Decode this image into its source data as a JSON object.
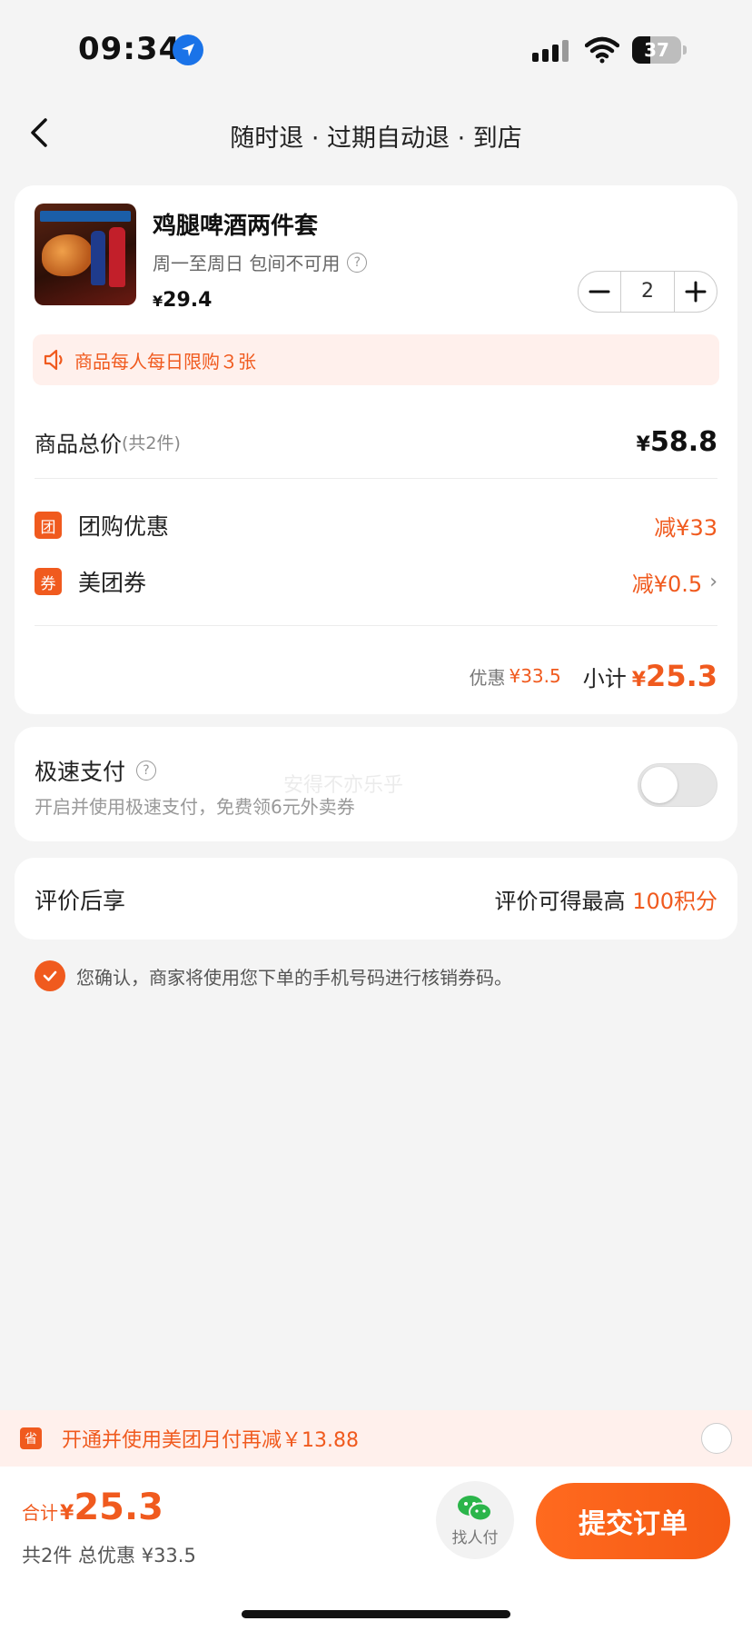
{
  "status_bar": {
    "time": "09:34",
    "battery": "37"
  },
  "nav": {
    "title": "随时退 · 过期自动退 · 到店"
  },
  "product": {
    "name": "鸡腿啤酒两件套",
    "availability": "周一至周日 包间不可用",
    "price_symbol": "¥",
    "price": "29.4",
    "quantity": "2",
    "limit_notice": "商品每人每日限购３张"
  },
  "summary": {
    "total_label": "商品总价",
    "total_count": "(共2件)",
    "total_symbol": "¥",
    "total_value": "58.8",
    "discounts": [
      {
        "badge": "团",
        "label": "团购优惠",
        "value": "减¥33"
      },
      {
        "badge": "券",
        "label": "美团券",
        "value": "减¥0.5"
      }
    ],
    "saving_label": "优惠",
    "saving_value": "¥33.5",
    "subtotal_label": "小计",
    "subtotal_symbol": "¥",
    "subtotal_value": "25.3"
  },
  "quick_pay": {
    "title": "极速支付",
    "description": "开启并使用极速支付，免费领6元外卖券",
    "watermark": "安得不亦乐乎",
    "enabled": false
  },
  "review": {
    "label": "评价后享",
    "prefix": "评价可得最高",
    "points": "100积分"
  },
  "confirm": {
    "text": "您确认，商家将使用您下单的手机号码进行核销券码。",
    "checked": true
  },
  "promo": {
    "icon": "省",
    "text": "开通并使用美团月付再减￥13.88"
  },
  "bottom": {
    "sum_label": "合计",
    "sum_symbol": "¥",
    "sum_value": "25.3",
    "sum_detail": "共2件  总优惠 ¥33.5",
    "friend_pay_label": "找人付",
    "submit_label": "提交订单"
  },
  "colors": {
    "accent": "#f05a1e",
    "background": "#f4f4f4",
    "card": "#ffffff"
  }
}
